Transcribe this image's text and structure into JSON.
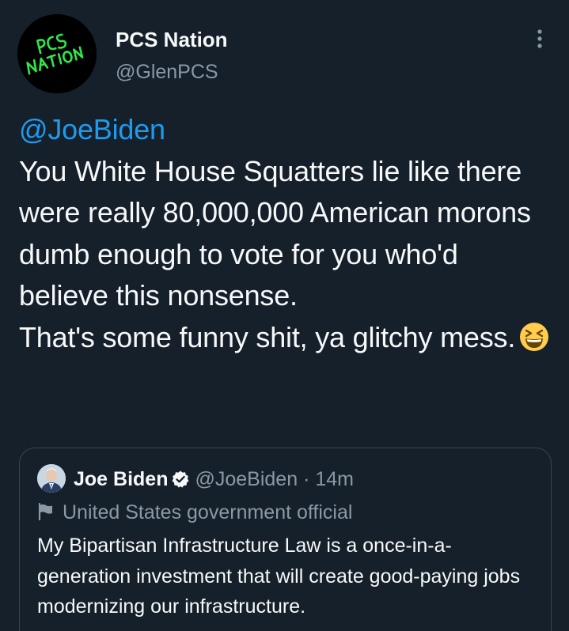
{
  "author": {
    "display_name": "PCS Nation",
    "handle": "@GlenPCS",
    "avatar_text": "PCS NATION"
  },
  "tweet": {
    "mention": "@JoeBiden",
    "body": "You White House Squatters lie like there were really 80,000,000 American morons dumb enough to vote for you who'd believe this nonsense.\nThat's some funny shit, ya glitchy mess.",
    "emoji": "grinning-squinting-face"
  },
  "quoted_tweet": {
    "display_name": "Joe Biden",
    "verified": true,
    "handle": "@JoeBiden",
    "separator": "·",
    "time": "14m",
    "label": "United States government official",
    "body": "My Bipartisan Infrastructure Law is a once-in-a-generation investment that will create good-paying jobs modernizing our infrastructure."
  },
  "icons": {
    "more": "more-vertical-icon",
    "verified": "verified-badge-icon",
    "government": "flag-icon"
  },
  "colors": {
    "background": "#15202b",
    "mention": "#1d9bf0",
    "secondary_text": "#8b98a5",
    "border": "#38444d",
    "avatar_text": "#2ee84a"
  }
}
